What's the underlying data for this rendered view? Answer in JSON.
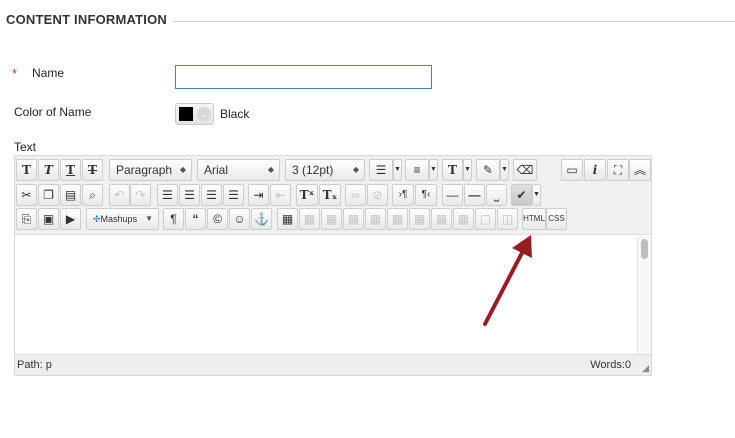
{
  "section": {
    "title": "CONTENT INFORMATION"
  },
  "name_field": {
    "required_marker": "*",
    "label": "Name",
    "value": "",
    "placeholder": ""
  },
  "color_field": {
    "label": "Color of Name",
    "value_text": "Black",
    "swatch_color": "#000000"
  },
  "text_field": {
    "label": "Text"
  },
  "toolbar": {
    "paragraph": "Paragraph",
    "font": "Arial",
    "size": "3 (12pt)",
    "mashups": "Mashups",
    "html": "HTML",
    "css": "CSS",
    "bold": "T",
    "italic": "T",
    "underline": "T",
    "strike": "T",
    "superscript": "Tˣ",
    "subscript": "Tₓ",
    "text_color": "T",
    "quote": "“",
    "copyright": "©",
    "paragraph_mark": "¶",
    "info": "i",
    "ltr": "›¶",
    "rtl": "¶‹"
  },
  "status": {
    "path": "Path: p",
    "words": "Words:0"
  },
  "colors": {
    "arrow": "#9b1b22",
    "input_border": "#3a8ea8",
    "required": "#c0392b"
  }
}
